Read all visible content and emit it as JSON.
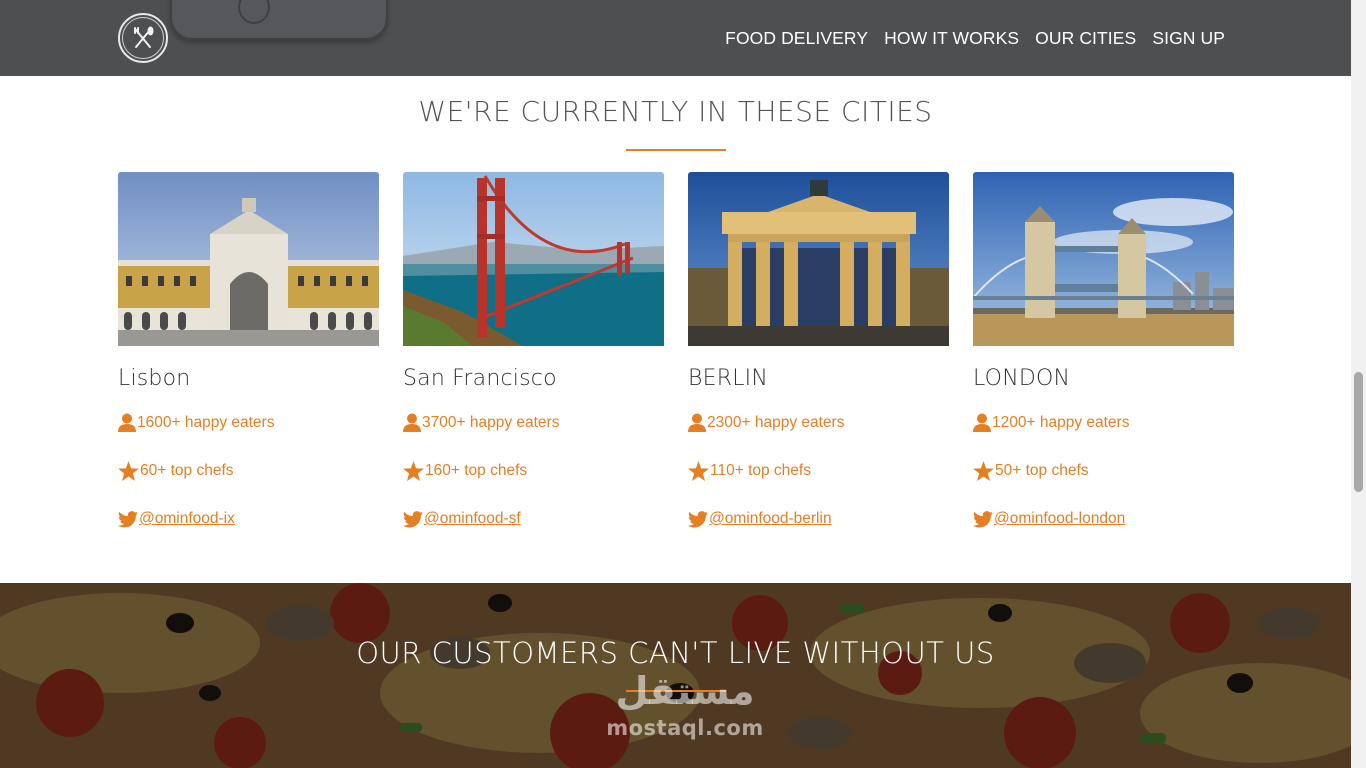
{
  "header": {
    "logo_icon": "fork-knife-icon",
    "nav": [
      "FOOD DELIVERY",
      "HOW IT WORKS",
      "OUR CITIES",
      "SIGN UP"
    ]
  },
  "cities_section": {
    "title": "WE'RE CURRENTLY IN THESE CITIES",
    "accent_color": "#e67e22",
    "cities": [
      {
        "name": "Lisbon",
        "eaters": "1600+ happy eaters",
        "chefs": "60+ top chefs",
        "twitter": "@ominfood-ix"
      },
      {
        "name": "San Francisco",
        "eaters": "3700+ happy eaters",
        "chefs": "160+ top chefs",
        "twitter": "@ominfood-sf"
      },
      {
        "name": "BERLIN",
        "eaters": "2300+ happy eaters",
        "chefs": "110+ top chefs",
        "twitter": "@ominfood-berlin"
      },
      {
        "name": "LONDON",
        "eaters": "1200+ happy eaters",
        "chefs": "50+ top chefs",
        "twitter": "@ominfood-london"
      }
    ]
  },
  "testimonials": {
    "title": "OUR CUSTOMERS CAN'T LIVE WITHOUT US",
    "watermark_ar": "مستقل",
    "watermark_latin": "mostaql.com"
  }
}
